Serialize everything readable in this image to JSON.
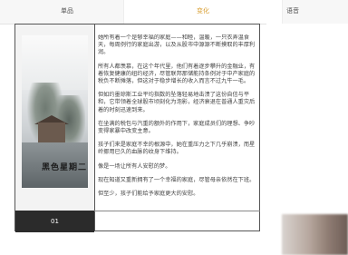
{
  "tabs": [
    {
      "label": "单品"
    },
    {
      "label": "变化"
    },
    {
      "label": "语音"
    }
  ],
  "book": {
    "cover_title": "黑色星期二",
    "cover_subtitle": "",
    "id": "01"
  },
  "paragraphs": [
    "她所有着一个是够幸福的家庭——和睦，温暖，一只衣弄温食天，每周例行的家庭出游，以及从股市中源源不断摸取的丰厚利润。",
    "所有人都羡慕，在这个年代里，他们有着逐步攀升的金融业，有着恢复健康的纽约经济，尽管联邦那储能持条例对于中产家庭的税负不断摊落，但这对于稳步增长的收入而言不过九牛一毛。",
    "但如约墨琼斯工业平均指数的坠落轻易地击溃了这份自信与平和，它带领着全球股市顷刻化为泡影，经济衰退在普通人重灾后着的时刻迅速到来。",
    "在坐满的税包与汽重的额外的作用下，家庭成员们的理想、争吵变得家暴中改变主意。",
    "孩子们来是家庭不幸的根源中，她在重压力之下几乎崩溃，而星岭挪用已久的血脉的纹身下维持。",
    "像是一场让所有人安慰的梦。",
    "现在知道又重新拥有了一个幸福的家庭，尽管母亲依然在下班。",
    "但至少，孩子们能给予家庭更大的安慰。"
  ]
}
